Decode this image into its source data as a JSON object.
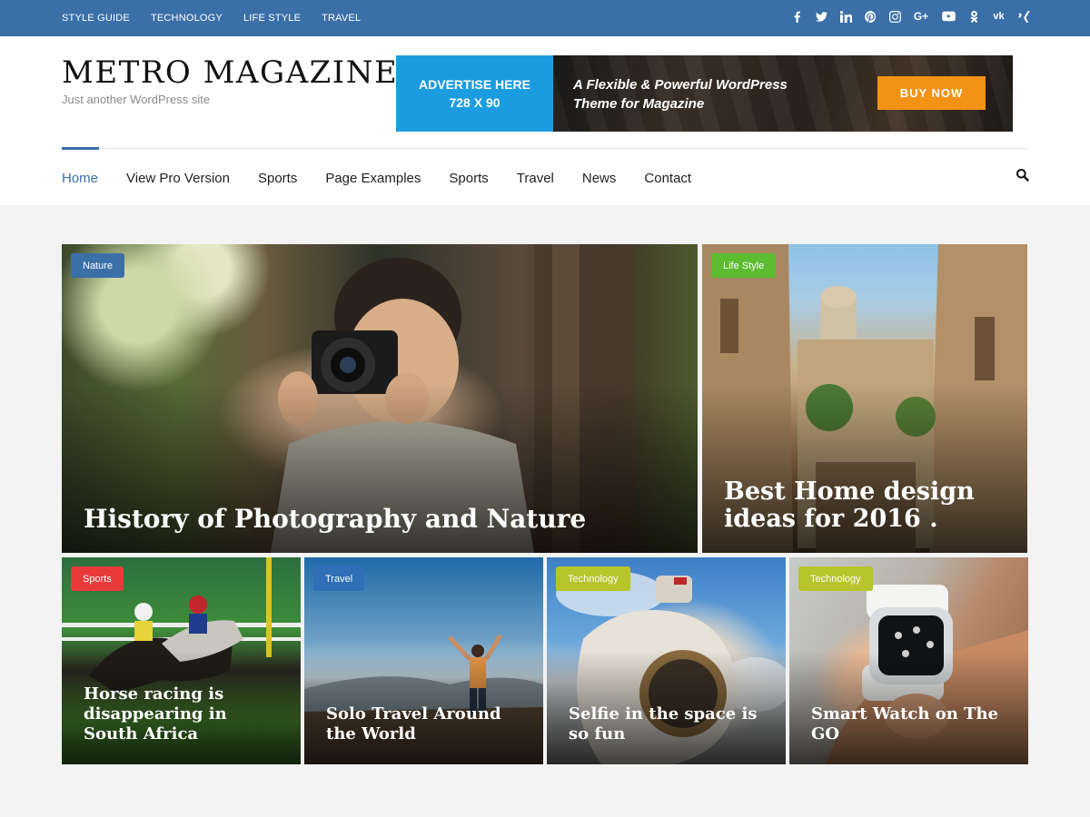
{
  "topbar": {
    "links": [
      "STYLE GUIDE",
      "TECHNOLOGY",
      "LIFE STYLE",
      "TRAVEL"
    ],
    "social_icons": [
      "facebook-icon",
      "twitter-icon",
      "linkedin-icon",
      "pinterest-icon",
      "instagram-icon",
      "google-plus-icon",
      "youtube-icon",
      "odnoklassniki-icon",
      "vk-icon",
      "xing-icon"
    ],
    "bg_color": "#3b6fa8"
  },
  "header": {
    "site_title": "METRO MAGAZINE",
    "tagline": "Just another WordPress site"
  },
  "ad": {
    "left_line1": "ADVERTISE HERE",
    "left_line2": "728 X 90",
    "text_line1": "A Flexible & Powerful WordPress",
    "text_line2": "Theme for Magazine",
    "button": "BUY NOW"
  },
  "nav": {
    "items": [
      "Home",
      "View Pro Version",
      "Sports",
      "Page Examples",
      "Sports",
      "Travel",
      "News",
      "Contact"
    ],
    "active": "Home",
    "search_icon": "search-icon"
  },
  "posts": [
    {
      "category": "Nature",
      "badge_color": "#3b6fa8",
      "title": "History of Photography and Nature"
    },
    {
      "category": "Life Style",
      "badge_color": "#5bbd2f",
      "title": "Best Home design ideas for 2016 ."
    },
    {
      "category": "Sports",
      "badge_color": "#e93a3a",
      "title": "Horse racing is disappearing in South Africa"
    },
    {
      "category": "Travel",
      "badge_color": "#2f6fb8",
      "title": "Solo Travel Around the World"
    },
    {
      "category": "Technology",
      "badge_color": "#b7c52a",
      "title": "Selfie in the space is so fun"
    },
    {
      "category": "Technology",
      "badge_color": "#b7c52a",
      "title": "Smart Watch on The GO"
    }
  ]
}
